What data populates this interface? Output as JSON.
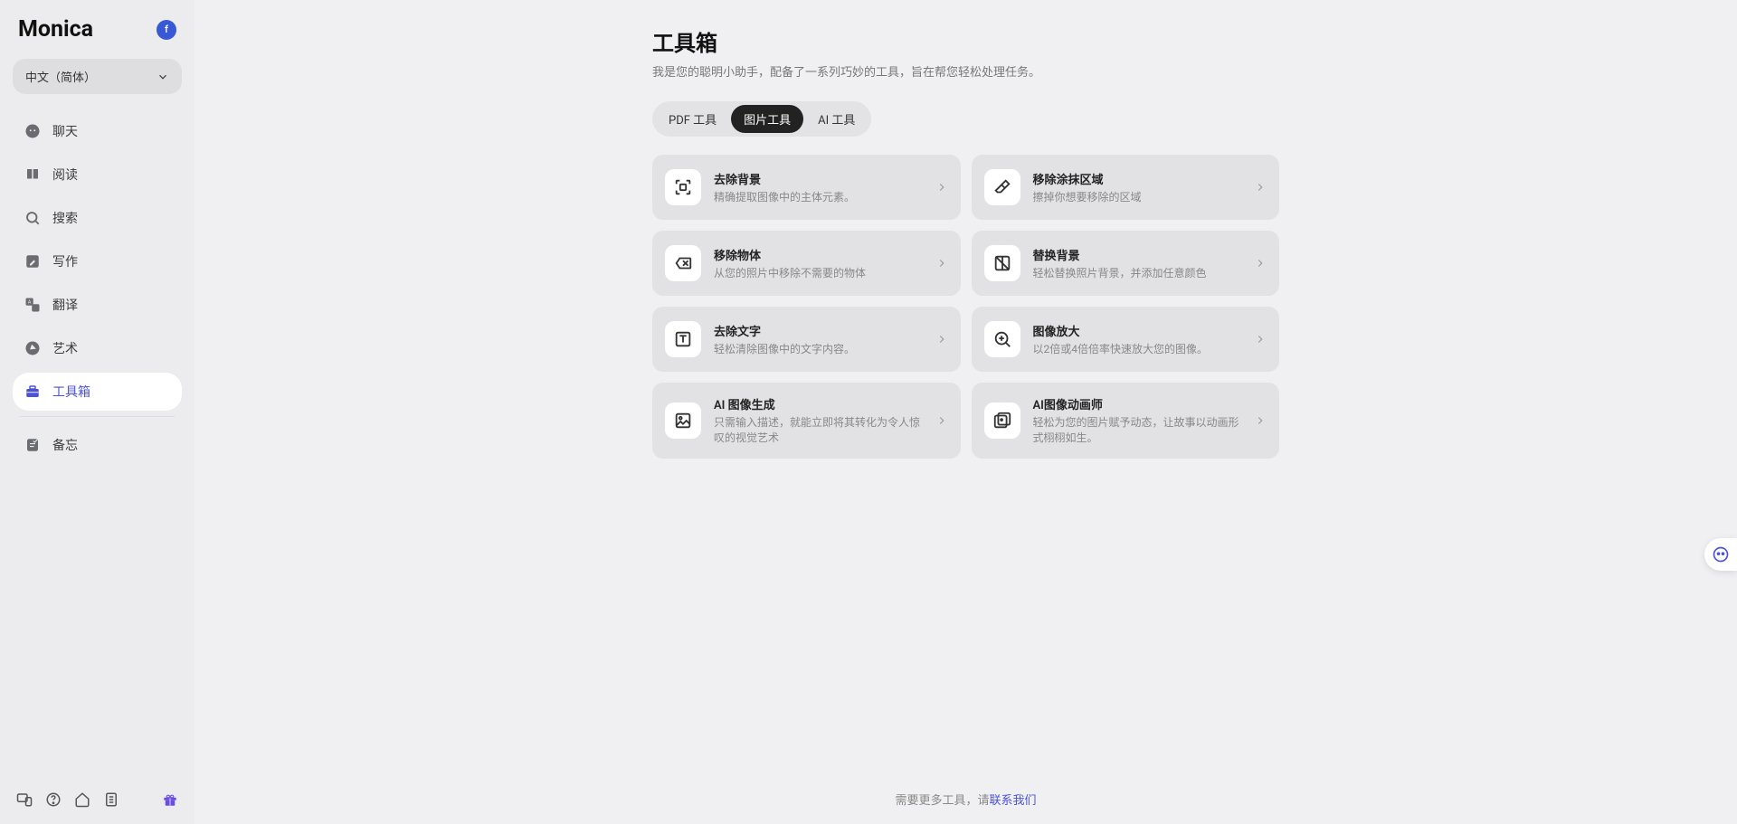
{
  "app": {
    "name": "Monica",
    "account_initial": "f"
  },
  "language": {
    "label": "中文（简体）"
  },
  "sidebar": {
    "items": [
      {
        "label": "聊天"
      },
      {
        "label": "阅读"
      },
      {
        "label": "搜索"
      },
      {
        "label": "写作"
      },
      {
        "label": "翻译"
      },
      {
        "label": "艺术"
      },
      {
        "label": "工具箱"
      },
      {
        "label": "备忘"
      }
    ]
  },
  "page": {
    "title": "工具箱",
    "subtitle": "我是您的聪明小助手，配备了一系列巧妙的工具，旨在帮您轻松处理任务。"
  },
  "tabs": [
    {
      "label": "PDF 工具"
    },
    {
      "label": "图片工具"
    },
    {
      "label": "AI 工具"
    }
  ],
  "tools": [
    {
      "title": "去除背景",
      "desc": "精确提取图像中的主体元素。",
      "icon": "scan"
    },
    {
      "title": "移除涂抹区域",
      "desc": "擦掉你想要移除的区域",
      "icon": "eraser"
    },
    {
      "title": "移除物体",
      "desc": "从您的照片中移除不需要的物体",
      "icon": "remove-object"
    },
    {
      "title": "替换背景",
      "desc": "轻松替换照片背景，并添加任意颜色",
      "icon": "replace-bg"
    },
    {
      "title": "去除文字",
      "desc": "轻松清除图像中的文字内容。",
      "icon": "text"
    },
    {
      "title": "图像放大",
      "desc": "以2倍或4倍倍率快速放大您的图像。",
      "icon": "zoom"
    },
    {
      "title": "AI 图像生成",
      "desc": "只需输入描述，就能立即将其转化为令人惊叹的视觉艺术",
      "icon": "photo"
    },
    {
      "title": "AI图像动画师",
      "desc": "轻松为您的图片赋予动态，让故事以动画形式栩栩如生。",
      "icon": "animate"
    }
  ],
  "footer": {
    "text": "需要更多工具，请",
    "link": "联系我们"
  }
}
